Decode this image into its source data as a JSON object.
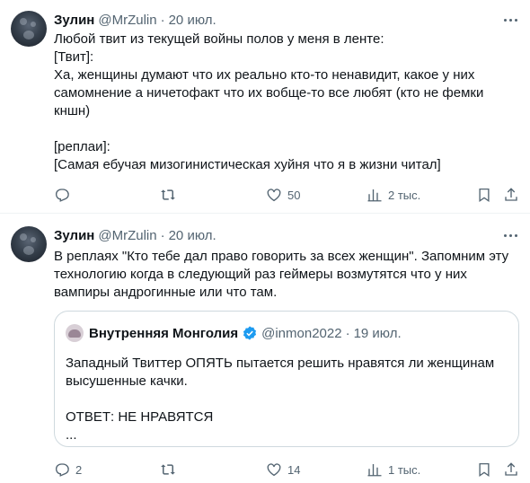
{
  "tweets": [
    {
      "author_name": "Зулин",
      "author_handle": "@MrZulin",
      "separator": "·",
      "date": "20 июл.",
      "text": "Любой твит из текущей войны полов у меня в ленте:\n[Твит]:\nХа, женщины думают что их реально кто-то ненавидит, какое у них самомнение а ничетофакт что их вобще-то все любят (кто не фемки кншн)\n\n[реплаи]:\n[Самая ебучая мизогинистическая хуйня что я в жизни читал]",
      "replies": "",
      "reposts": "",
      "likes": "50",
      "views": "2 тыс."
    },
    {
      "author_name": "Зулин",
      "author_handle": "@MrZulin",
      "separator": "·",
      "date": "20 июл.",
      "text": "В реплаях \"Кто тебе дал право говорить за всех женщин\". Запомним эту технологию когда в следующий раз геймеры возмутятся что у них вампиры андрогинные или что там.",
      "quote": {
        "author_name": "Внутренняя Монголия",
        "author_handle": "@inmon2022",
        "separator": "·",
        "date": "19 июл.",
        "text": "Западный Твиттер ОПЯТЬ пытается решить нравятся ли женщинам высушенные качки.\n\nОТВЕТ: НЕ НРАВЯТСЯ\n..."
      },
      "replies": "2",
      "reposts": "",
      "likes": "14",
      "views": "1 тыс."
    }
  ],
  "icons": {
    "reply": "reply-icon",
    "repost": "repost-icon",
    "like": "like-icon",
    "views": "views-icon",
    "bookmark": "bookmark-icon",
    "share": "share-icon",
    "more": "more-icon",
    "verified": "verified-badge-icon"
  },
  "colors": {
    "text": "#0f1419",
    "secondary": "#536471",
    "border": "#eff3f4",
    "verified": "#1d9bf0"
  }
}
